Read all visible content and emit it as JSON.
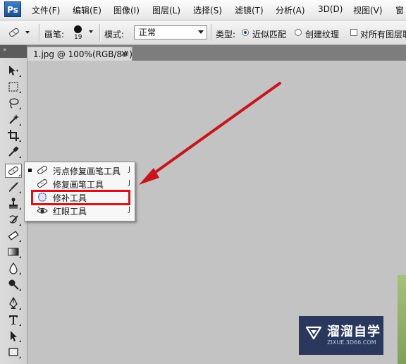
{
  "app": {
    "logo_text": "Ps"
  },
  "menubar": {
    "items": [
      "文件(F)",
      "编辑(E)",
      "图像(I)",
      "图层(L)",
      "选择(S)",
      "滤镜(T)",
      "分析(A)",
      "3D(D)",
      "视图(V)",
      "窗"
    ]
  },
  "options_bar": {
    "brush_label": "画笔:",
    "brush_size": "19",
    "mode_label": "模式:",
    "mode_value": "正常",
    "type_label": "类型:",
    "type_options": [
      "近似匹配",
      "创建纹理"
    ],
    "type_selected": "近似匹配",
    "sample_all_layers_label": "对所有图层取",
    "sample_all_layers_checked": false
  },
  "panel_strip": {
    "collapse_glyph": "»"
  },
  "document_tab": {
    "label": "1.jpg @ 100%(RGB/8#)",
    "close_glyph": "✕"
  },
  "tools_flyout": {
    "items": [
      {
        "label": "污点修复画笔工具",
        "shortcut": "J",
        "icon": "spot-healing-brush-icon",
        "current": true
      },
      {
        "label": "修复画笔工具",
        "shortcut": "J",
        "icon": "healing-brush-icon",
        "current": false
      },
      {
        "label": "修补工具",
        "shortcut": "J",
        "icon": "patch-icon",
        "current": false
      },
      {
        "label": "红眼工具",
        "shortcut": "J",
        "icon": "red-eye-icon",
        "current": false
      }
    ]
  },
  "annotation": {
    "highlighted_item": "修补工具",
    "color": "#d4141a"
  },
  "watermark": {
    "title": "溜溜自学",
    "url": "ZIXUE.3D66.COM"
  },
  "colors": {
    "canvas": "#c3c3c3",
    "annotation_red": "#d4141a"
  }
}
